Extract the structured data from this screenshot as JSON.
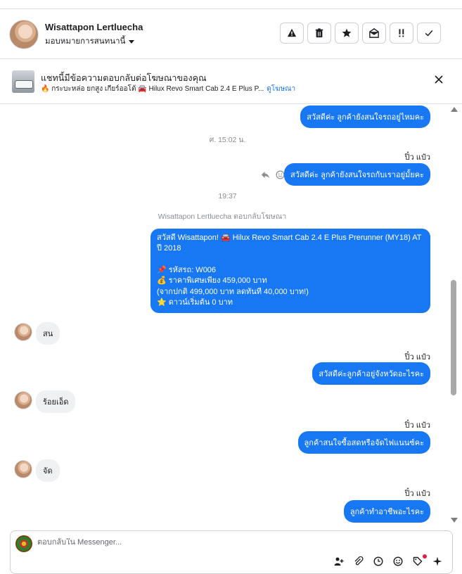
{
  "header": {
    "contact_name": "Wisattapon Lertluecha",
    "assign_label": "มอบหมายการสนทนานี้"
  },
  "toolbar": {
    "icons": [
      "alert-icon",
      "trash-icon",
      "star-icon",
      "open-envelope-icon",
      "priority-icon",
      "check-icon"
    ]
  },
  "ad_banner": {
    "title": "แชทนี้มีข้อความตอบกลับต่อโฆษณาของคุณ",
    "subtitle": "🔥 กระบะหล่อ ยกสูง เกียร์ออโต้ 🚘 Hilux Revo Smart Cab 2.4 E Plus P...",
    "link": "ดูโฆษณา"
  },
  "chat": {
    "messages": {
      "m1": "สวัสดีค่ะ ลูกค้ายังสนใจรถอยู่ไหมคะ",
      "ts1": "ศ. 15:02 น.",
      "sender2": "ปิ๋ว แป๋ว",
      "m2": "สวัสดีค่ะ ลูกค้ายังสนใจรถกับเราอยู่มั้ยคะ",
      "ts2": "19:37",
      "reply_note": "Wisattapon Lertluecha ตอบกลับโฆษณา",
      "ad_reply": [
        "สวัสดี Wisattapon! 🚘 Hilux Revo Smart Cab 2.4 E Plus Prerunner (MY18) AT ปี 2018",
        "",
        "📌 รหัสรถ: W006",
        "💰 ราคาพิเศษเพียง 459,000 บาท",
        "(จากปกติ 499,000 บาท ลดทันที 40,000 บาท!)",
        "⭐ ดาวน์เริ่มต้น 0 บาท"
      ],
      "in1": "สน",
      "sender3": "ปิ๋ว แป๋ว",
      "m3": "สวัสดีค่ะลูกค้าอยู่จังหวัดอะไรคะ",
      "in2": "ร้อยเอ็ด",
      "sender4": "ปิ๋ว แป๋ว",
      "m4": "ลูกค้าสนใจซื้อสดหรือจัดไฟแนนซ์คะ",
      "in3": "จัด",
      "sender5": "ปิ๋ว แป๋ว",
      "m5": "ลูกค้าทำอาชีพอะไรคะ"
    }
  },
  "composer": {
    "placeholder": "ตอบกลับใน Messenger..."
  },
  "colors": {
    "outgoing_bubble": "#1877f2",
    "incoming_bubble": "#eef0f2",
    "link": "#1877f2"
  }
}
